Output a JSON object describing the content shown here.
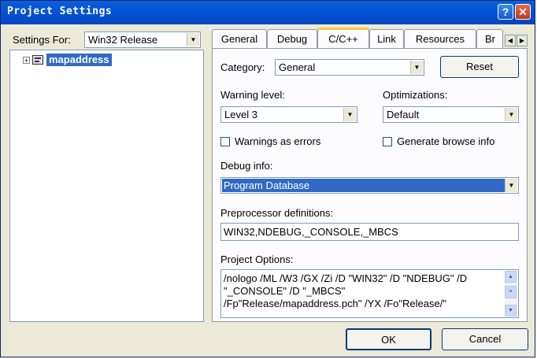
{
  "window": {
    "title": "Project Settings",
    "help_glyph": "?",
    "close_glyph": "✕"
  },
  "settings_for": {
    "label": "Settings For:",
    "value": "Win32 Release"
  },
  "tree": {
    "expander": "+",
    "project": "mapaddress"
  },
  "tabs": [
    {
      "label": "General"
    },
    {
      "label": "Debug"
    },
    {
      "label": "C/C++"
    },
    {
      "label": "Link"
    },
    {
      "label": "Resources"
    },
    {
      "label": "Br"
    }
  ],
  "active_tab": "C/C++",
  "tab_scroll": {
    "left": "◀",
    "right": "▶"
  },
  "category": {
    "label": "Category:",
    "value": "General"
  },
  "reset_button": "Reset",
  "warning_level": {
    "label": "Warning level:",
    "value": "Level 3"
  },
  "optimizations": {
    "label": "Optimizations:",
    "value": "Default"
  },
  "warnings_as_errors": {
    "label": "Warnings as errors",
    "checked": false
  },
  "generate_browse_info": {
    "label": "Generate browse info",
    "checked": false
  },
  "debug_info": {
    "label": "Debug info:",
    "value": "Program Database"
  },
  "preprocessor": {
    "label": "Preprocessor definitions:",
    "value": "WIN32,NDEBUG,_CONSOLE,_MBCS"
  },
  "project_options": {
    "label": "Project Options:",
    "lines": [
      "/nologo /ML /W3 /GX /Zi /D \"WIN32\" /D \"NDEBUG\" /D",
      "\"_CONSOLE\" /D \"_MBCS\"",
      "/Fp\"Release/mapaddress.pch\" /YX /Fo\"Release/\""
    ]
  },
  "ok_button": "OK",
  "cancel_button": "Cancel",
  "colors": {
    "titlebar": "#0454d6",
    "dialog_bg": "#ece9d8",
    "selection": "#316ac5"
  }
}
